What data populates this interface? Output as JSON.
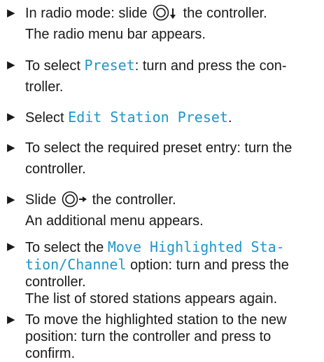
{
  "bullet_glyph": "▶",
  "colors": {
    "highlight": "#1f96c8",
    "text": "#1a1a1a"
  },
  "steps": [
    {
      "before_icon": "In radio mode: slide ",
      "icon": "controller-slide-down-icon",
      "after_icon": " the controller.",
      "result": "The radio menu bar appears."
    },
    {
      "before": "To select ",
      "highlight": "Preset",
      "after_line1": ": turn and press the con-",
      "line2": "troller."
    },
    {
      "before": "Select ",
      "highlight": "Edit Station Preset",
      "after": "."
    },
    {
      "line1": "To select the required preset entry: turn the",
      "line2": "controller."
    },
    {
      "before_icon": "Slide ",
      "icon": "controller-slide-right-icon",
      "after_icon": " the controller.",
      "result": "An additional menu appears."
    },
    {
      "before": "To select the ",
      "highlight_line1": "Move Highlighted Sta-",
      "highlight_line2": "tion/Channel",
      "after_line2": " option: turn and press the",
      "line3": "controller.",
      "result": "The list of stored stations appears again."
    },
    {
      "line1": "To move the highlighted station to the new",
      "line2": "position: turn the controller and press to",
      "line3": "confirm."
    }
  ]
}
